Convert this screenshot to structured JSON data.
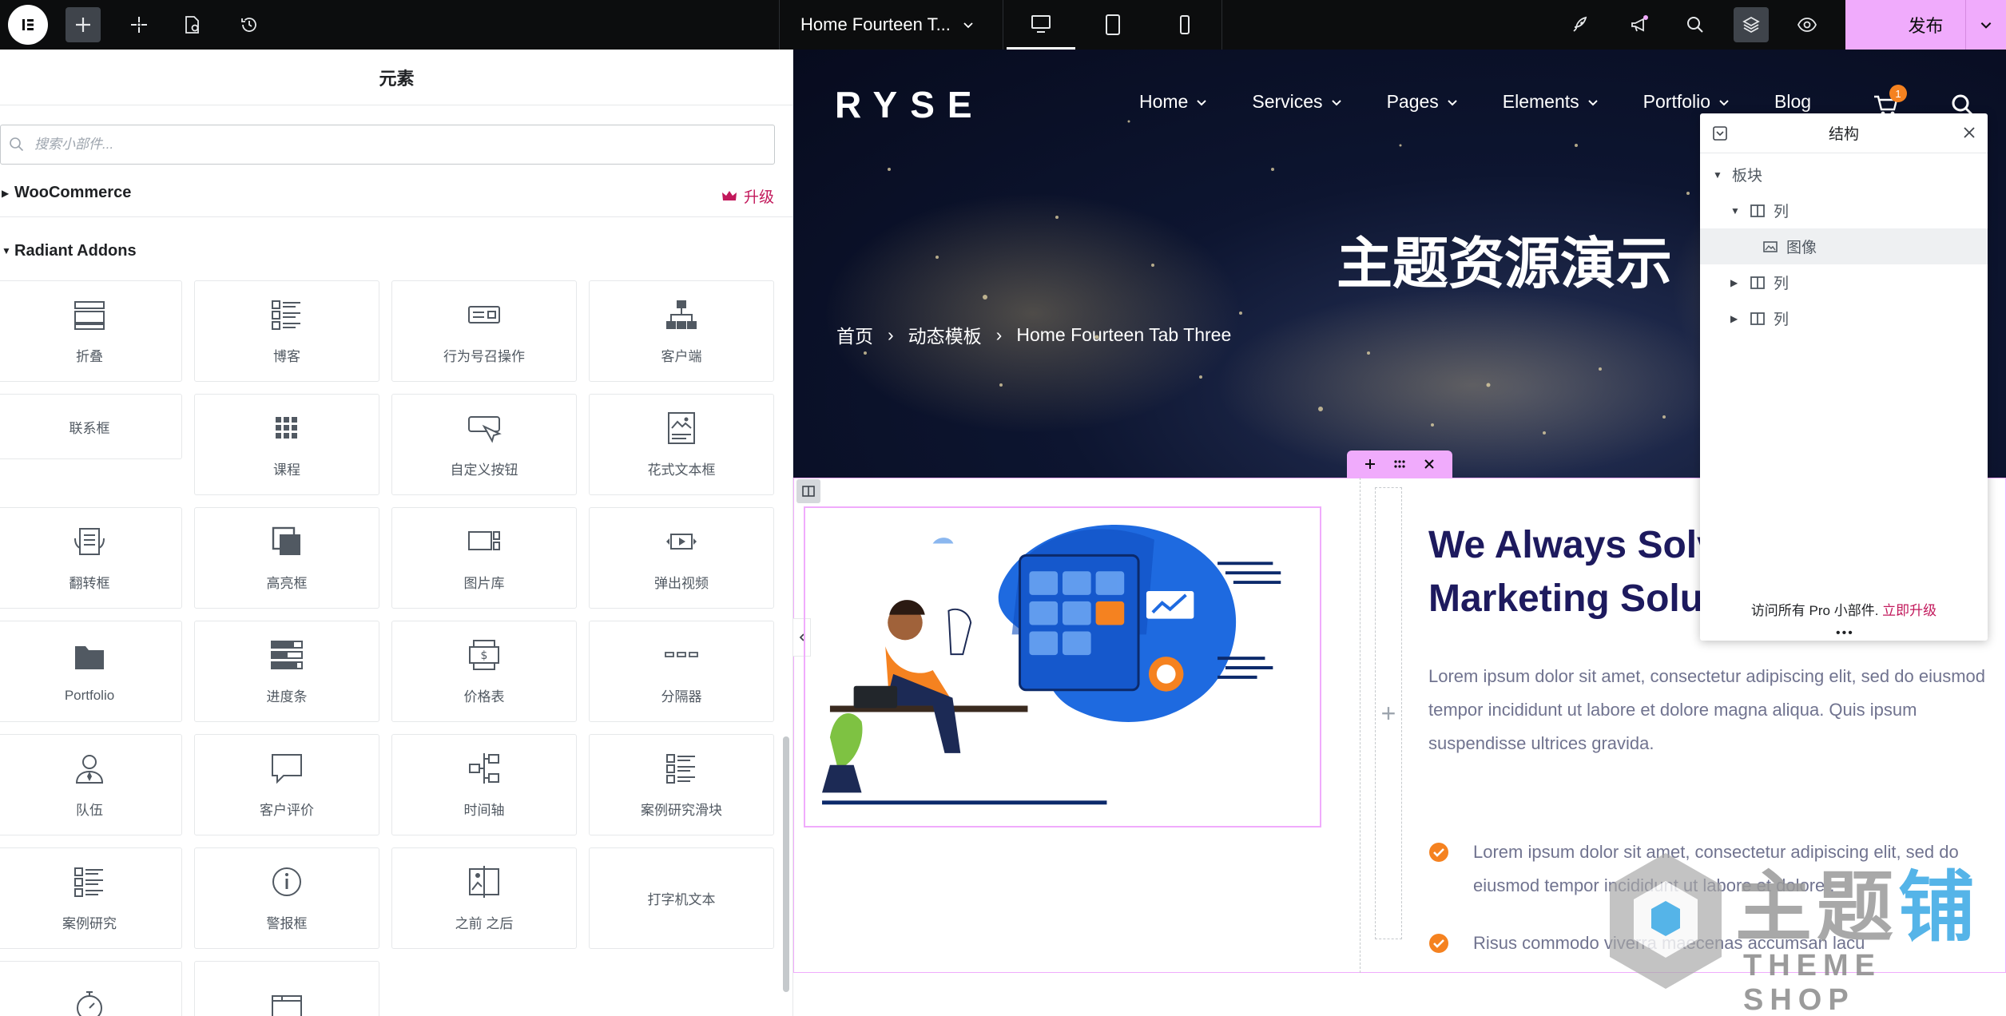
{
  "topbar": {
    "doc_title": "Home Fourteen T...",
    "publish_label": "发布"
  },
  "panel": {
    "title": "元素",
    "search_placeholder": "搜索小部件...",
    "categories": [
      {
        "label": "WooCommerce",
        "upgrade": "升级"
      },
      {
        "label": "Radiant Addons"
      }
    ],
    "widgets": [
      {
        "label": "折叠",
        "icon": "accordion-icon"
      },
      {
        "label": "博客",
        "icon": "blog-list-icon"
      },
      {
        "label": "行为号召操作",
        "icon": "call-to-action-icon"
      },
      {
        "label": "客户端",
        "icon": "sitemap-icon"
      },
      {
        "label": "联系框",
        "icon": ""
      },
      {
        "label": "课程",
        "icon": "grid-dots-icon"
      },
      {
        "label": "自定义按钮",
        "icon": "cursor-button-icon"
      },
      {
        "label": "花式文本框",
        "icon": "image-box-icon"
      },
      {
        "label": "翻转框",
        "icon": "flip-box-icon"
      },
      {
        "label": "高亮框",
        "icon": "highlight-box-icon"
      },
      {
        "label": "图片库",
        "icon": "gallery-icon"
      },
      {
        "label": "弹出视频",
        "icon": "video-play-icon"
      },
      {
        "label": "Portfolio",
        "icon": "folder-icon"
      },
      {
        "label": "进度条",
        "icon": "progress-bars-icon"
      },
      {
        "label": "价格表",
        "icon": "price-table-icon"
      },
      {
        "label": "分隔器",
        "icon": "divider-icon"
      },
      {
        "label": "队伍",
        "icon": "team-member-icon"
      },
      {
        "label": "客户评价",
        "icon": "testimonial-icon"
      },
      {
        "label": "时间轴",
        "icon": "timeline-icon"
      },
      {
        "label": "案例研究滑块",
        "icon": "case-slider-icon"
      },
      {
        "label": "案例研究",
        "icon": "case-study-icon"
      },
      {
        "label": "警报框",
        "icon": "alert-icon"
      },
      {
        "label": "之前 之后",
        "icon": "before-after-icon"
      },
      {
        "label": "打字机文本",
        "icon": ""
      },
      {
        "label": "",
        "icon": "stopwatch-icon"
      },
      {
        "label": "",
        "icon": "tabs-icon"
      }
    ]
  },
  "site": {
    "logo": "RYSE",
    "nav": [
      "Home",
      "Services",
      "Pages",
      "Elements",
      "Portfolio",
      "Blog"
    ],
    "cart_count": "1",
    "hero_title": "主题资源演示",
    "breadcrumb": [
      "首页",
      "动态模板",
      "Home Fourteen Tab Three"
    ],
    "heading_line1": "We Always Solv",
    "heading_line2": "Marketing Solut",
    "paragraph": "Lorem ipsum dolor sit amet, consectetur adipiscing elit, sed do eiusmod tempor incididunt ut labore et dolore magna aliqua. Quis ipsum suspendisse ultrices gravida.",
    "list": [
      "Lorem ipsum dolor sit amet, consectetur adipiscing elit, sed do eiusmod tempor incididunt ut labore et dolore .",
      "Risus commodo viverra maecenas accumsan lacu"
    ]
  },
  "structure": {
    "title": "结构",
    "items": [
      {
        "label": "板块"
      },
      {
        "label": "列"
      },
      {
        "label": "图像"
      },
      {
        "label": "列"
      },
      {
        "label": "列"
      }
    ],
    "footer_text": "访问所有 Pro 小部件.",
    "footer_link": "立即升级"
  },
  "watermark": {
    "cn_a": "主题",
    "cn_b": "铺",
    "en": "THEME SHOP"
  },
  "colors": {
    "accent_pink": "#f0abfc",
    "hero_navy": "#0d1530",
    "heading_navy": "#1d1a5e",
    "check_orange": "#f58220",
    "upgrade_red": "#c2185b"
  }
}
